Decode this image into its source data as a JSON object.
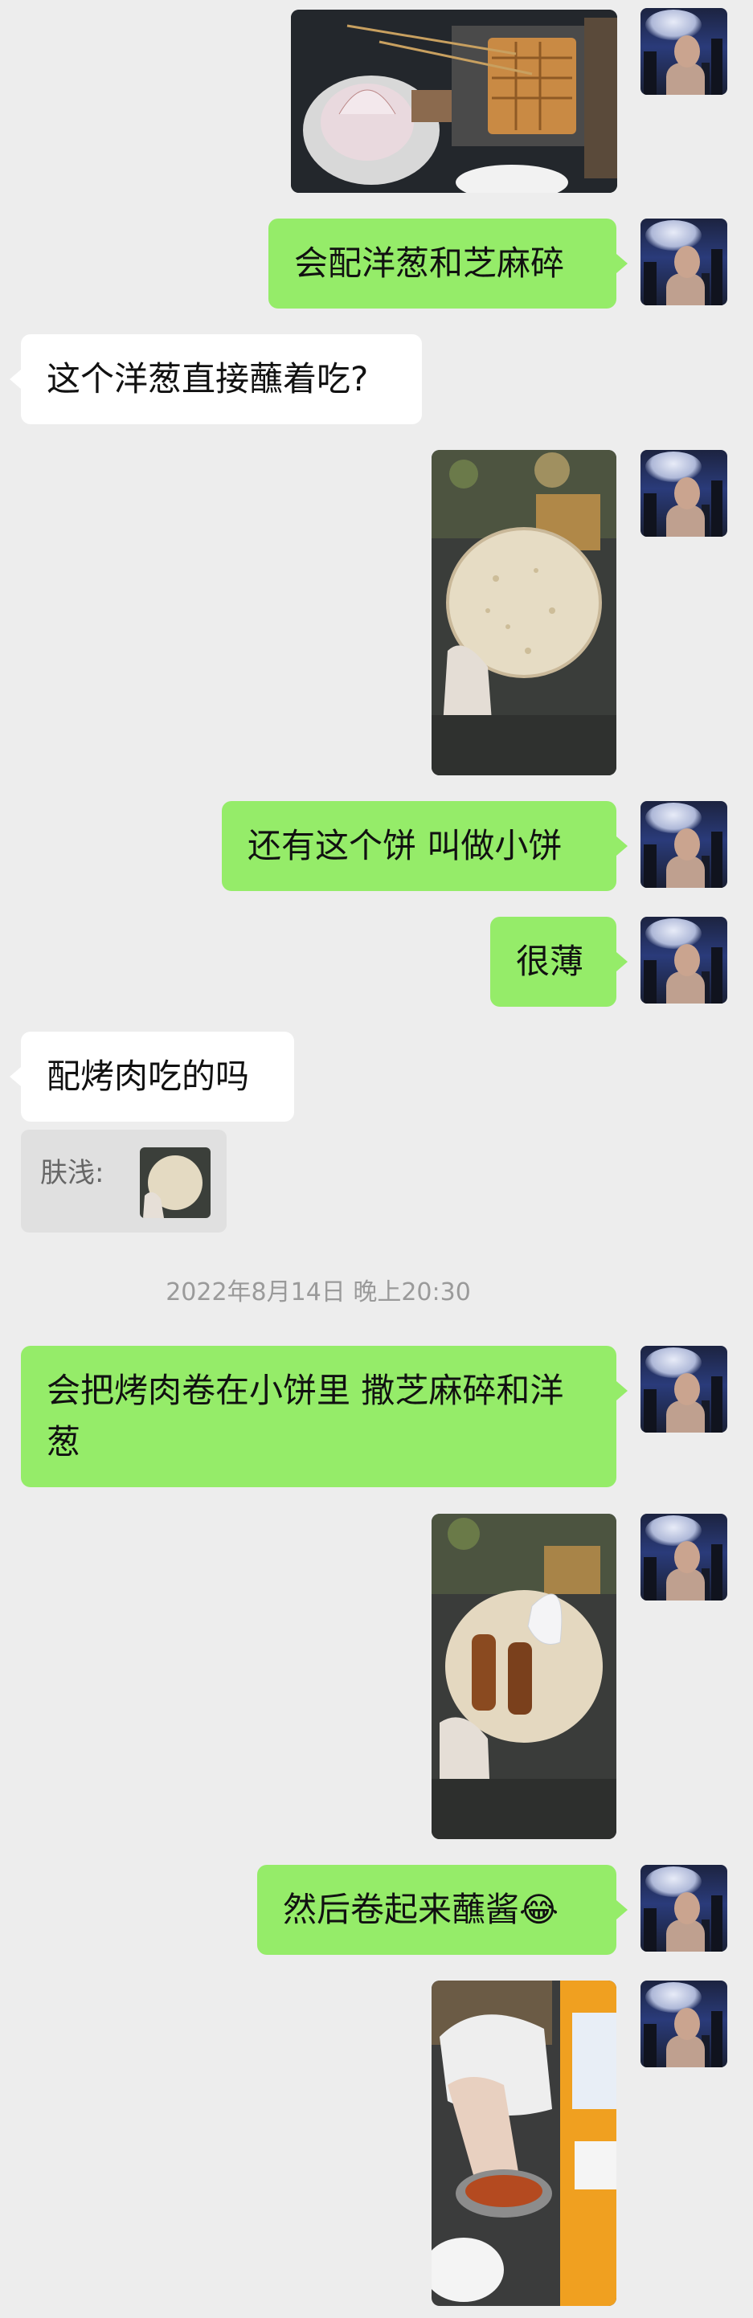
{
  "messages": [
    {
      "type": "image",
      "side": "me",
      "desc": "skewers-onion-photo"
    },
    {
      "type": "text",
      "side": "me",
      "text": "会配洋葱和芝麻碎"
    },
    {
      "type": "text",
      "side": "other",
      "text": "这个洋葱直接蘸着吃?"
    },
    {
      "type": "image",
      "side": "me",
      "desc": "flatbread-photo"
    },
    {
      "type": "text",
      "side": "me",
      "text": "还有这个饼 叫做小饼"
    },
    {
      "type": "text",
      "side": "me",
      "text": "很薄"
    },
    {
      "type": "text",
      "side": "other",
      "text": "配烤肉吃的吗"
    },
    {
      "type": "quote",
      "side": "other",
      "text": "肤浅:"
    },
    {
      "type": "timestamp",
      "text": "2022年8月14日 晚上20:30"
    },
    {
      "type": "text",
      "side": "me",
      "text": "会把烤肉卷在小饼里 撒芝麻碎和洋葱"
    },
    {
      "type": "image",
      "side": "me",
      "desc": "meat-in-bread-photo"
    },
    {
      "type": "text",
      "side": "me",
      "text": "然后卷起来蘸酱😂"
    },
    {
      "type": "image",
      "side": "me",
      "desc": "dipping-sauce-photo"
    }
  ],
  "colors": {
    "background": "#ededed",
    "my_bubble": "#95ec69",
    "their_bubble": "#ffffff",
    "timestamp": "#9a9a9a"
  }
}
